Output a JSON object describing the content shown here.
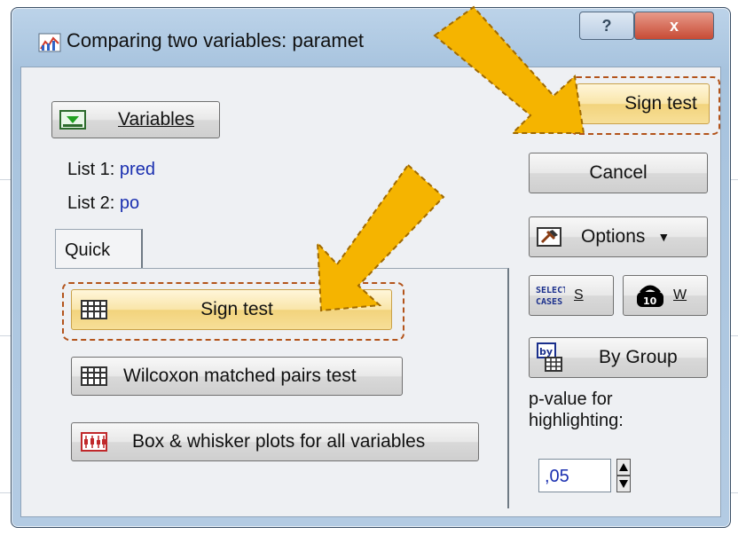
{
  "window": {
    "title": "Comparing two variables: paramet",
    "help_glyph": "?",
    "close_glyph": "x"
  },
  "variables_button": {
    "label": "Variables",
    "icon": "variables-icon"
  },
  "lists": [
    {
      "label": "List 1:",
      "value": "pred"
    },
    {
      "label": "List 2:",
      "value": "po"
    }
  ],
  "tabs": [
    {
      "label": "Quick"
    }
  ],
  "quick": {
    "sign_test": "Sign test",
    "wilcoxon": "Wilcoxon matched pairs test",
    "boxplots": "Box & whisker plots for all variables"
  },
  "side": {
    "ok_label": "Sign test",
    "cancel_label": "Cancel",
    "options_label": "Options",
    "select_cases_icon_text": "SELECT\nCASES",
    "select_cases_key": "S",
    "weights_key": "W",
    "by_group_label": "By Group",
    "by_group_icon_text": "by",
    "pvalue_label": "p-value for highlighting:",
    "pvalue_value": ",05"
  },
  "colors": {
    "highlight_arrow": "#f5b400",
    "selection_dash": "#b3541b",
    "value_text": "#1a2fb0"
  }
}
